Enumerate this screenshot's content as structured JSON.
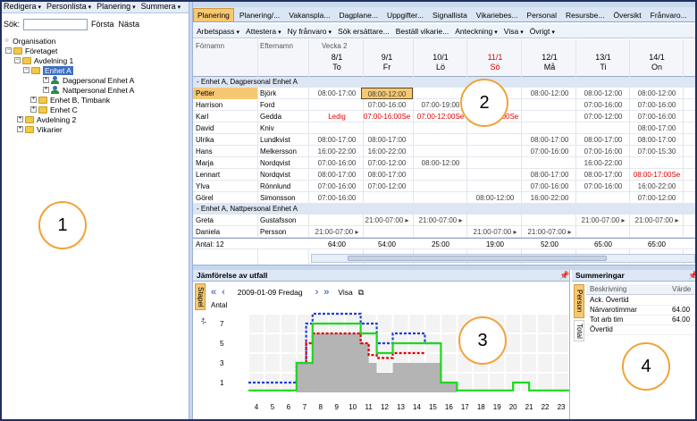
{
  "menubar": [
    "Redigera",
    "Personlista",
    "Planering",
    "Summera"
  ],
  "search": {
    "label": "Sök:",
    "first": "Första",
    "next": "Nästa",
    "value": ""
  },
  "tree": {
    "root": "Organisation",
    "company": "Företaget",
    "dept1": "Avdelning 1",
    "unitA": "Enhet A",
    "day": "Dagpersonal Enhet A",
    "night": "Nattpersonal Enhet A",
    "unitB": "Enhet B, Timbank",
    "unitC": "Enhet C",
    "dept2": "Avdelning 2",
    "subs": "Vikarier"
  },
  "callouts": [
    "1",
    "2",
    "3",
    "4"
  ],
  "tabs": [
    "Planering",
    "Planering/...",
    "Vakanspla...",
    "Dagplane...",
    "Uppgifter...",
    "Signallista",
    "Vikariebes...",
    "Personal",
    "Resursbe...",
    "Översikt",
    "Frånvaro..."
  ],
  "toolbar": [
    "Arbetspass",
    "Attestera",
    "Ny frånvaro",
    "Sök ersättare...",
    "Beställ vikarie...",
    "Anteckning",
    "Visa",
    "Övrigt"
  ],
  "grid": {
    "col_first": "Förnamn",
    "col_last": "Efternamn",
    "week": "Vecka 2",
    "days": [
      {
        "date": "8/1",
        "day": "To",
        "red": false
      },
      {
        "date": "9/1",
        "day": "Fr",
        "red": false
      },
      {
        "date": "10/1",
        "day": "Lö",
        "red": false
      },
      {
        "date": "11/1",
        "day": "Sö",
        "red": true
      },
      {
        "date": "12/1",
        "day": "Må",
        "red": false
      },
      {
        "date": "13/1",
        "day": "Ti",
        "red": false
      },
      {
        "date": "14/1",
        "day": "On",
        "red": false
      }
    ],
    "group1": "- Enhet A, Dagpersonal Enhet A",
    "group2": "- Enhet A, Nattpersonal Enhet A",
    "rows1": [
      {
        "first": "Petter",
        "last": "Björk",
        "shifts": [
          "08:00-17:00",
          "08:00-12:00",
          "",
          "",
          "08:00-12:00",
          "08:00-12:00",
          "08:00-12:00"
        ]
      },
      {
        "first": "Harrison",
        "last": "Ford",
        "shifts": [
          "",
          "07:00-16:00",
          "07:00-19:00",
          "",
          "",
          "07:00-16:00",
          "07:00-16:00"
        ]
      },
      {
        "first": "Karl",
        "last": "Gedda",
        "shifts": [
          "Ledig",
          "07:00-16:00Se",
          "07:00-12:00Se",
          "07:00-12:00Se",
          "",
          "07:00-12:00",
          "07:00-16:00"
        ]
      },
      {
        "first": "David",
        "last": "Kniv",
        "shifts": [
          "",
          "",
          "",
          "",
          "",
          "",
          "08:00-17:00"
        ]
      },
      {
        "first": "Ulrika",
        "last": "Lundkvist",
        "shifts": [
          "08:00-17:00",
          "08:00-17:00",
          "",
          "",
          "08:00-17:00",
          "08:00-17:00",
          "08:00-17:00"
        ]
      },
      {
        "first": "Hans",
        "last": "Melkersson",
        "shifts": [
          "16:00-22:00",
          "16:00-22:00",
          "",
          "",
          "07:00-16:00",
          "07:00-16:00",
          "07:00-15:30"
        ]
      },
      {
        "first": "Marja",
        "last": "Nordqvist",
        "shifts": [
          "07:00-16:00",
          "07:00-12:00",
          "08:00-12:00",
          "",
          "",
          "16:00-22:00",
          ""
        ]
      },
      {
        "first": "Lennart",
        "last": "Nordqvist",
        "shifts": [
          "08:00-17:00",
          "08:00-17:00",
          "",
          "",
          "08:00-17:00",
          "08:00-17:00",
          "08:00-17:00Se"
        ]
      },
      {
        "first": "Ylva",
        "last": "Rönnlund",
        "shifts": [
          "07:00-16:00",
          "07:00-12:00",
          "",
          "",
          "07:00-16:00",
          "07:00-16:00",
          "16:00-22:00"
        ]
      },
      {
        "first": "Görel",
        "last": "Simonsson",
        "shifts": [
          "07:00-16:00",
          "",
          "",
          "08:00-12:00",
          "16:00-22:00",
          "",
          "07:00-12:00"
        ]
      }
    ],
    "rows2": [
      {
        "first": "Greta",
        "last": "Gustafsson",
        "shifts": [
          "",
          "21:00-07:00 ▸",
          "21:00-07:00 ▸",
          "",
          "",
          "21:00-07:00 ▸",
          "21:00-07:00 ▸"
        ]
      },
      {
        "first": "Daniela",
        "last": "Persson",
        "shifts": [
          "21:00-07:00 ▸",
          "",
          "",
          "21:00-07:00 ▸",
          "21:00-07:00 ▸",
          "",
          ""
        ]
      }
    ],
    "total_label": "Antal: 12",
    "totals": [
      "64:00",
      "54:00",
      "25:00",
      "19:00",
      "52:00",
      "65:00",
      "65:00"
    ]
  },
  "compare": {
    "title": "Jämförelse av utfall",
    "side_tab": "Stapel",
    "side_plus": "+/-",
    "date": "2009-01-09 Fredag",
    "view": "Visa",
    "antal": "Antal",
    "y_ticks": [
      "7",
      "5",
      "3",
      "1"
    ],
    "x_ticks": [
      "4",
      "5",
      "6",
      "7",
      "8",
      "9",
      "10",
      "11",
      "12",
      "13",
      "14",
      "15",
      "16",
      "17",
      "18",
      "19",
      "20",
      "21",
      "22",
      "23"
    ]
  },
  "summary": {
    "title": "Summeringar",
    "tab1": "Person",
    "tab2": "Total",
    "col1": "Beskrivning",
    "col2": "Värde",
    "rows": [
      {
        "label": "Ack. Övertid",
        "value": ""
      },
      {
        "label": "Närvarotimmar",
        "value": "64.00"
      },
      {
        "label": "Tot arb tim",
        "value": "64.00"
      },
      {
        "label": "Övertid",
        "value": ""
      }
    ]
  },
  "colors": {
    "accent": "#f7c873",
    "highlight": "#f2a33a",
    "blue": "#1f3fd8",
    "green": "#1ed81e",
    "red": "#e00000",
    "gray": "#b4b4b4"
  }
}
